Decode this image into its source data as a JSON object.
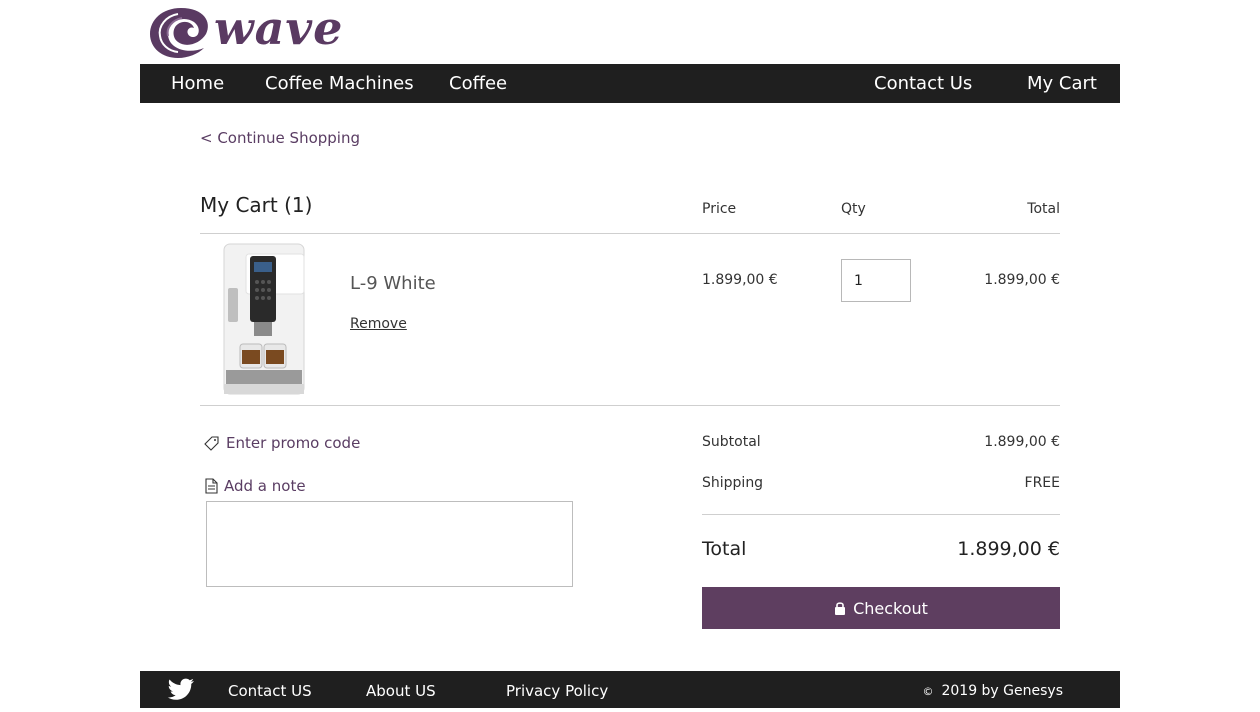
{
  "brand": {
    "logo_text": "wave",
    "accent_color": "#5e3e60"
  },
  "nav": {
    "items": [
      {
        "label": "Home"
      },
      {
        "label": "Coffee Machines"
      },
      {
        "label": "Coffee"
      },
      {
        "label": "Contact Us"
      },
      {
        "label": "My Cart"
      }
    ]
  },
  "cart": {
    "continue_label": "< Continue Shopping",
    "title": "My Cart (1)",
    "columns": {
      "price": "Price",
      "qty": "Qty",
      "total": "Total"
    },
    "items": [
      {
        "name": "L-9 White",
        "remove_label": "Remove",
        "price": "1.899,00 €",
        "qty": "1",
        "total": "1.899,00 €"
      }
    ],
    "promo_label": "Enter promo code",
    "note_label": "Add a note",
    "note_value": ""
  },
  "summary": {
    "subtotal_label": "Subtotal",
    "subtotal_value": "1.899,00 €",
    "shipping_label": "Shipping",
    "shipping_value": "FREE",
    "total_label": "Total",
    "total_value": "1.899,00 €",
    "checkout_label": "Checkout"
  },
  "footer": {
    "links": [
      {
        "label": "Contact US"
      },
      {
        "label": "About US"
      },
      {
        "label": "Privacy Policy"
      }
    ],
    "copyright_symbol": "©",
    "copyright_text": "2019 by Genesys"
  }
}
